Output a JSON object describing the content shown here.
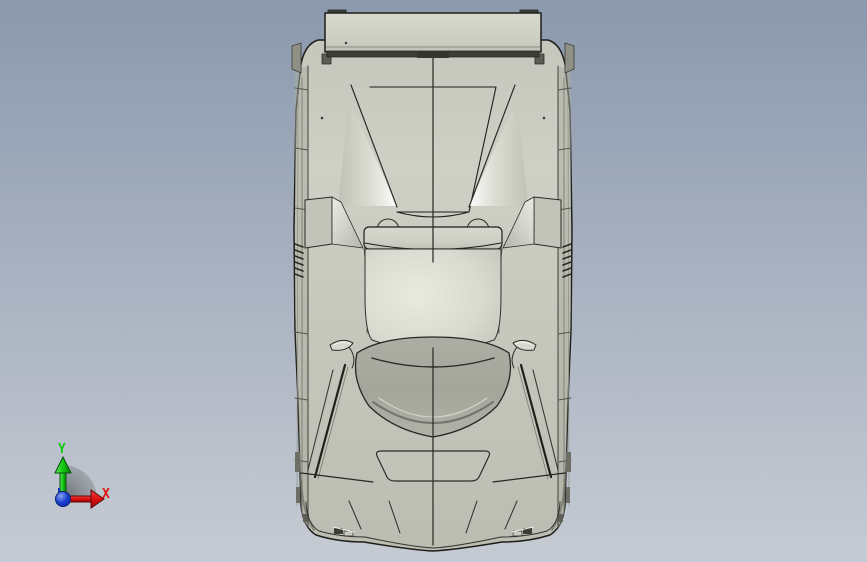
{
  "viewport": {
    "type": "cad-3d-viewport",
    "view": "top",
    "background_top": "#8b99ae",
    "background_bottom": "#c6cbd3"
  },
  "model": {
    "kind": "car-body-shell",
    "shading": "shaded-with-edges"
  },
  "triad": {
    "x_label": "X",
    "y_label": "Y",
    "x_axis_color": "#dd1111",
    "y_axis_color": "#12c812",
    "origin_color": "#1c3ecf",
    "rotation_indicator_color": "#a9aeb5"
  },
  "colors": {
    "bg-top": "#8b99ae",
    "bg-bottom": "#c6cbd3",
    "body": "#c9cabf",
    "body-bright": "#e9eae0",
    "glass": "#a4a59b",
    "edge": "#1d1e1a",
    "wing": "#d0d1c6",
    "endplate": "#3e4336",
    "axis-x": "#dd1111",
    "axis-y": "#12c812",
    "origin": "#1c3ecf",
    "fan": "#a9aeb5"
  }
}
